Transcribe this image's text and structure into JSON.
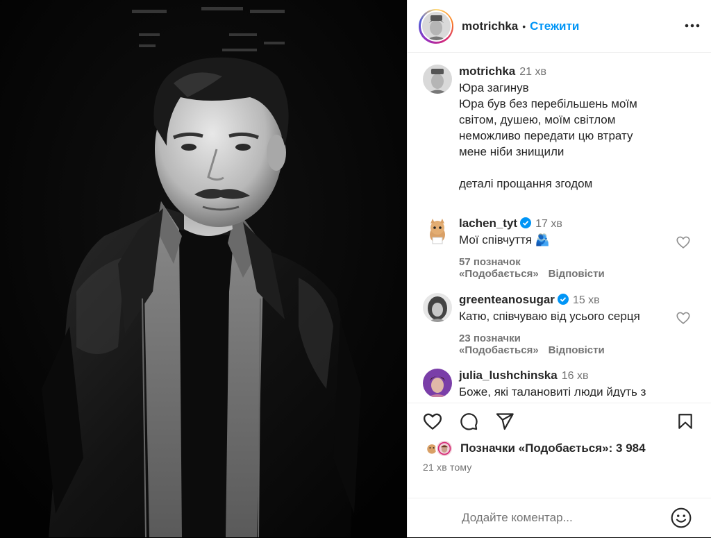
{
  "post": {
    "author": "motrichka",
    "dot": "•",
    "follow_label": "Стежити",
    "more_icon": "more-horizontal-icon"
  },
  "caption": {
    "username": "motrichka",
    "time": "21 хв",
    "lines": [
      "Юра загинув",
      "Юра був без перебільшень моїм світом, душею, моїм світлом",
      "неможливо передати цю втрату",
      "мене ніби знищили",
      "",
      "деталі прощання згодом"
    ]
  },
  "comments": [
    {
      "username": "lachen_tyt",
      "verified": true,
      "time": "17 хв",
      "text": "Мої співчуття 🫂",
      "likes": "57 позначок «Подобається»",
      "reply": "Відповісти"
    },
    {
      "username": "greenteanosugar",
      "verified": true,
      "time": "15 хв",
      "text": "Катю, співчуваю від усього серця",
      "likes": "23 позначки «Подобається»",
      "reply": "Відповісти"
    },
    {
      "username": "julia_lushchinska",
      "verified": false,
      "time": "16 хв",
      "text": "Боже, які талановиті люди йдуть з"
    }
  ],
  "actions": {
    "like_icon": "heart-icon",
    "comment_icon": "comment-icon",
    "share_icon": "send-icon",
    "save_icon": "bookmark-icon"
  },
  "likes_summary": "Позначки «Подобається»: 3 984",
  "post_time": "21 хв тому",
  "add_comment": {
    "placeholder": "Додайте коментар...",
    "emoji_icon": "smiley-icon"
  },
  "colors": {
    "link": "#0095f6",
    "verified": "#0095f6",
    "secondary_text": "#737373"
  }
}
